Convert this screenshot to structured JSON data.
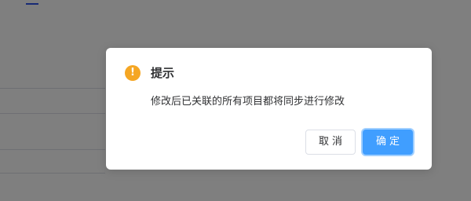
{
  "dialog": {
    "icon": "exclamation-icon",
    "icon_glyph": "!",
    "title": "提示",
    "message": "修改后已关联的所有项目都将同步进行修改",
    "cancel_label": "取消",
    "confirm_label": "确定"
  },
  "colors": {
    "warning": "#f5a623",
    "primary": "#409eff",
    "overlay": "rgba(0,0,0,0.5)"
  }
}
